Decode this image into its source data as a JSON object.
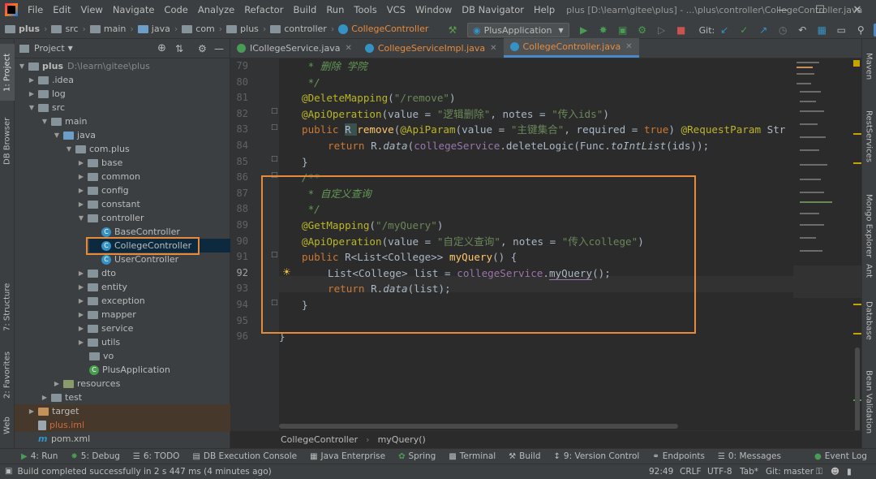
{
  "menubar": {
    "items": [
      "File",
      "Edit",
      "View",
      "Navigate",
      "Code",
      "Analyze",
      "Refactor",
      "Build",
      "Run",
      "Tools",
      "VCS",
      "Window",
      "DB Navigator",
      "Help"
    ],
    "title": "plus [D:\\learn\\gitee\\plus] - ...\\plus\\controller\\CollegeController.java"
  },
  "navbar": {
    "crumbs": [
      "plus",
      "src",
      "main",
      "java",
      "com",
      "plus",
      "controller",
      "CollegeController"
    ],
    "run_config": "PlusApplication",
    "git_label": "Git:"
  },
  "left_strip": [
    "1: Project",
    "DB Browser",
    "7: Structure",
    "2: Favorites",
    "Web"
  ],
  "right_strip": [
    "Maven",
    "RestServices",
    "Mongo Explorer",
    "Ant",
    "Database",
    "Bean Validation"
  ],
  "project": {
    "header": "Project",
    "tree": [
      {
        "label": "plus",
        "hint": "D:\\learn\\gitee\\plus"
      },
      {
        "label": ".idea"
      },
      {
        "label": "log"
      },
      {
        "label": "src"
      },
      {
        "label": "main"
      },
      {
        "label": "java"
      },
      {
        "label": "com.plus"
      },
      {
        "label": "base"
      },
      {
        "label": "common"
      },
      {
        "label": "config"
      },
      {
        "label": "constant"
      },
      {
        "label": "controller"
      },
      {
        "label": "BaseController"
      },
      {
        "label": "CollegeController"
      },
      {
        "label": "UserController"
      },
      {
        "label": "dto"
      },
      {
        "label": "entity"
      },
      {
        "label": "exception"
      },
      {
        "label": "mapper"
      },
      {
        "label": "service"
      },
      {
        "label": "utils"
      },
      {
        "label": "vo"
      },
      {
        "label": "PlusApplication"
      },
      {
        "label": "resources"
      },
      {
        "label": "test"
      },
      {
        "label": "target"
      },
      {
        "label": "plus.iml"
      },
      {
        "label": "pom.xml"
      }
    ]
  },
  "tabs": [
    "ICollegeService.java",
    "CollegeServiceImpl.java",
    "CollegeController.java"
  ],
  "line_numbers": [
    "79",
    "80",
    "81",
    "82",
    "83",
    "84",
    "85",
    "86",
    "87",
    "88",
    "89",
    "90",
    "91",
    "92",
    "93",
    "94",
    "95",
    "96"
  ],
  "code": {
    "l79": " * 删除 学院",
    "l80": " */",
    "l81_ann": "@DeleteMapping",
    "l81_rest": "(",
    "l81_str": "\"/remove\"",
    "l81_end": ")",
    "l82_ann": "@ApiOperation",
    "l82_a": "(value = ",
    "l82_s1": "\"逻辑删除\"",
    "l82_b": ", notes = ",
    "l82_s2": "\"传入ids\"",
    "l82_c": ")",
    "l83_k": "public ",
    "l83_t": "R ",
    "l83_f": "remove",
    "l83_a": "(",
    "l83_ann": "@ApiParam",
    "l83_b": "(value = ",
    "l83_s": "\"主键集合\"",
    "l83_c": ", required = ",
    "l83_k2": "true",
    "l83_d": ") ",
    "l83_ann2": "@RequestParam",
    "l83_e": " Str",
    "l84_k": "return ",
    "l84_a": "R.",
    "l84_i": "data",
    "l84_b": "(",
    "l84_fld": "collegeService",
    "l84_c": ".deleteLogic(Func.",
    "l84_i2": "toIntList",
    "l84_d": "(ids));",
    "l85": "}",
    "l86": "/**",
    "l87": " * 自定义查询",
    "l88": " */",
    "l89_ann": "@GetMapping",
    "l89_a": "(",
    "l89_s": "\"/myQuery\"",
    "l89_b": ")",
    "l90_ann": "@ApiOperation",
    "l90_a": "(value = ",
    "l90_s1": "\"自定义查询\"",
    "l90_b": ", notes = ",
    "l90_s2": "\"传入college\"",
    "l90_c": ")",
    "l91_k": "public ",
    "l91_a": "R<List<College>> ",
    "l91_f": "myQuery",
    "l91_b": "() {",
    "l92_a": "List<College> list = ",
    "l92_fld": "collegeService",
    "l92_b": ".",
    "l92_m": "myQuery",
    "l92_c": "();",
    "l93_k": "return ",
    "l93_a": "R.",
    "l93_i": "data",
    "l93_b": "(list);",
    "l94": "}",
    "l96": "}"
  },
  "editor_breadcrumb": [
    "CollegeController",
    "myQuery()"
  ],
  "bottom_tabs": [
    "4: Run",
    "5: Debug",
    "6: TODO",
    "DB Execution Console",
    "Java Enterprise",
    "Spring",
    "Terminal",
    "Build",
    "9: Version Control",
    "Endpoints",
    "0: Messages",
    "Event Log"
  ],
  "status": {
    "message": "Build completed successfully in 2 s 447 ms (4 minutes ago)",
    "position": "92:49",
    "line_sep": "CRLF",
    "encoding": "UTF-8",
    "indent": "Tab*",
    "branch": "Git: master"
  },
  "colors": {
    "accent": "#e88a3a",
    "selection": "#0d293e",
    "keyword": "#cc7832",
    "string": "#6a8759"
  }
}
